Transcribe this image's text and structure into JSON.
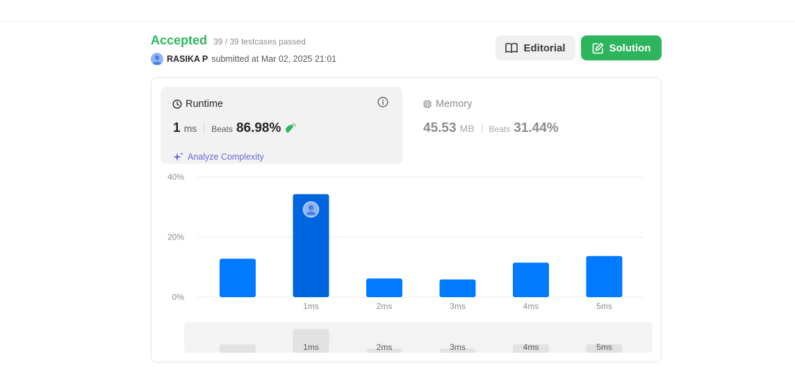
{
  "submission": {
    "status": "Accepted",
    "testcases": "39 / 39 testcases passed",
    "user": "RASIKA P",
    "submitted_text": "submitted at Mar 02, 2025 21:01"
  },
  "buttons": {
    "editorial": "Editorial",
    "solution": "Solution"
  },
  "runtime": {
    "title": "Runtime",
    "value": "1",
    "unit": "ms",
    "beats_label": "Beats",
    "beats": "86.98%",
    "analyze": "Analyze Complexity"
  },
  "memory": {
    "title": "Memory",
    "value": "45.53",
    "unit": "MB",
    "beats_label": "Beats",
    "beats": "31.44%"
  },
  "colors": {
    "accepted": "#2db55d",
    "bar": "#007aff",
    "bar_selected": "#0066e0",
    "analyze": "#6a6ad8"
  },
  "chart_data": {
    "type": "bar",
    "categories": [
      "",
      "1ms",
      "2ms",
      "3ms",
      "4ms",
      "5ms"
    ],
    "values": [
      12.8,
      34.3,
      6.2,
      5.9,
      11.5,
      13.7
    ],
    "yticks": [
      "0%",
      "20%",
      "40%"
    ],
    "ylim": [
      0,
      40
    ],
    "selected_index": 1,
    "overview_values": [
      3.0,
      8.5,
      1.5,
      1.5,
      3.0,
      3.0
    ],
    "overview_labels": [
      "",
      "1ms",
      "2ms",
      "3ms",
      "4ms",
      "5ms"
    ]
  }
}
